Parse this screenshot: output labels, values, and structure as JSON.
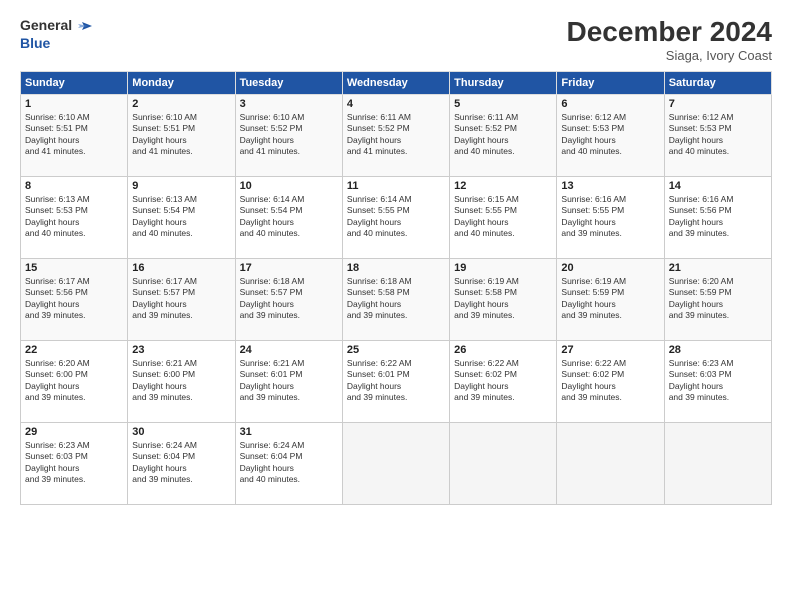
{
  "logo": {
    "line1": "General",
    "line2": "Blue"
  },
  "header": {
    "month": "December 2024",
    "location": "Siaga, Ivory Coast"
  },
  "days_of_week": [
    "Sunday",
    "Monday",
    "Tuesday",
    "Wednesday",
    "Thursday",
    "Friday",
    "Saturday"
  ],
  "weeks": [
    [
      {
        "day": "1",
        "sunrise": "6:10 AM",
        "sunset": "5:51 PM",
        "daylight": "11 hours and 41 minutes."
      },
      {
        "day": "2",
        "sunrise": "6:10 AM",
        "sunset": "5:51 PM",
        "daylight": "11 hours and 41 minutes."
      },
      {
        "day": "3",
        "sunrise": "6:10 AM",
        "sunset": "5:52 PM",
        "daylight": "11 hours and 41 minutes."
      },
      {
        "day": "4",
        "sunrise": "6:11 AM",
        "sunset": "5:52 PM",
        "daylight": "11 hours and 41 minutes."
      },
      {
        "day": "5",
        "sunrise": "6:11 AM",
        "sunset": "5:52 PM",
        "daylight": "11 hours and 40 minutes."
      },
      {
        "day": "6",
        "sunrise": "6:12 AM",
        "sunset": "5:53 PM",
        "daylight": "11 hours and 40 minutes."
      },
      {
        "day": "7",
        "sunrise": "6:12 AM",
        "sunset": "5:53 PM",
        "daylight": "11 hours and 40 minutes."
      }
    ],
    [
      {
        "day": "8",
        "sunrise": "6:13 AM",
        "sunset": "5:53 PM",
        "daylight": "11 hours and 40 minutes."
      },
      {
        "day": "9",
        "sunrise": "6:13 AM",
        "sunset": "5:54 PM",
        "daylight": "11 hours and 40 minutes."
      },
      {
        "day": "10",
        "sunrise": "6:14 AM",
        "sunset": "5:54 PM",
        "daylight": "11 hours and 40 minutes."
      },
      {
        "day": "11",
        "sunrise": "6:14 AM",
        "sunset": "5:55 PM",
        "daylight": "11 hours and 40 minutes."
      },
      {
        "day": "12",
        "sunrise": "6:15 AM",
        "sunset": "5:55 PM",
        "daylight": "11 hours and 40 minutes."
      },
      {
        "day": "13",
        "sunrise": "6:16 AM",
        "sunset": "5:55 PM",
        "daylight": "11 hours and 39 minutes."
      },
      {
        "day": "14",
        "sunrise": "6:16 AM",
        "sunset": "5:56 PM",
        "daylight": "11 hours and 39 minutes."
      }
    ],
    [
      {
        "day": "15",
        "sunrise": "6:17 AM",
        "sunset": "5:56 PM",
        "daylight": "11 hours and 39 minutes."
      },
      {
        "day": "16",
        "sunrise": "6:17 AM",
        "sunset": "5:57 PM",
        "daylight": "11 hours and 39 minutes."
      },
      {
        "day": "17",
        "sunrise": "6:18 AM",
        "sunset": "5:57 PM",
        "daylight": "11 hours and 39 minutes."
      },
      {
        "day": "18",
        "sunrise": "6:18 AM",
        "sunset": "5:58 PM",
        "daylight": "11 hours and 39 minutes."
      },
      {
        "day": "19",
        "sunrise": "6:19 AM",
        "sunset": "5:58 PM",
        "daylight": "11 hours and 39 minutes."
      },
      {
        "day": "20",
        "sunrise": "6:19 AM",
        "sunset": "5:59 PM",
        "daylight": "11 hours and 39 minutes."
      },
      {
        "day": "21",
        "sunrise": "6:20 AM",
        "sunset": "5:59 PM",
        "daylight": "11 hours and 39 minutes."
      }
    ],
    [
      {
        "day": "22",
        "sunrise": "6:20 AM",
        "sunset": "6:00 PM",
        "daylight": "11 hours and 39 minutes."
      },
      {
        "day": "23",
        "sunrise": "6:21 AM",
        "sunset": "6:00 PM",
        "daylight": "11 hours and 39 minutes."
      },
      {
        "day": "24",
        "sunrise": "6:21 AM",
        "sunset": "6:01 PM",
        "daylight": "11 hours and 39 minutes."
      },
      {
        "day": "25",
        "sunrise": "6:22 AM",
        "sunset": "6:01 PM",
        "daylight": "11 hours and 39 minutes."
      },
      {
        "day": "26",
        "sunrise": "6:22 AM",
        "sunset": "6:02 PM",
        "daylight": "11 hours and 39 minutes."
      },
      {
        "day": "27",
        "sunrise": "6:22 AM",
        "sunset": "6:02 PM",
        "daylight": "11 hours and 39 minutes."
      },
      {
        "day": "28",
        "sunrise": "6:23 AM",
        "sunset": "6:03 PM",
        "daylight": "11 hours and 39 minutes."
      }
    ],
    [
      {
        "day": "29",
        "sunrise": "6:23 AM",
        "sunset": "6:03 PM",
        "daylight": "11 hours and 39 minutes."
      },
      {
        "day": "30",
        "sunrise": "6:24 AM",
        "sunset": "6:04 PM",
        "daylight": "11 hours and 39 minutes."
      },
      {
        "day": "31",
        "sunrise": "6:24 AM",
        "sunset": "6:04 PM",
        "daylight": "11 hours and 40 minutes."
      },
      null,
      null,
      null,
      null
    ]
  ]
}
